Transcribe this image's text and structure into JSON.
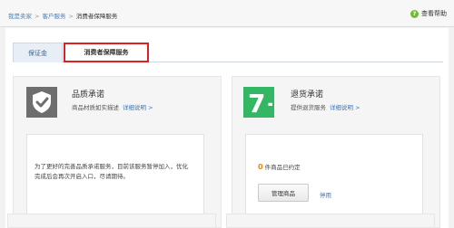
{
  "breadcrumb": {
    "home": "我是卖家",
    "section": "客户服务",
    "current": "消费者保障服务",
    "separator": ">"
  },
  "help": {
    "icon": "question-icon",
    "label": "查看帮助"
  },
  "tabs": [
    {
      "label": "保证金",
      "active": false
    },
    {
      "label": "消费者保障服务",
      "active": true,
      "highlighted": true
    }
  ],
  "quality_panel": {
    "icon": "shield-check-icon",
    "title": "品质承诺",
    "desc": "商品材质如实描述",
    "detail_link": "详细说明 >",
    "notice": "为了更好的完善品质承诺服务，目前该服务暂停加入，优化完成后会再次开启入口，尽请期待。"
  },
  "return_panel": {
    "icon": "seven-day-return-icon",
    "logo_text": "7+",
    "title": "退货承诺",
    "desc": "提供退货服务",
    "detail_link": "详细说明 >",
    "count_value": "0",
    "count_suffix": "件商品已约定",
    "manage_button": "管理商品",
    "stop_link": "停用"
  },
  "colors": {
    "accent_green": "#33b765",
    "link_blue": "#3f76b4",
    "highlight_red": "#e02020",
    "count_orange": "#ff7f00",
    "quality_gray": "#6e6e6e"
  }
}
